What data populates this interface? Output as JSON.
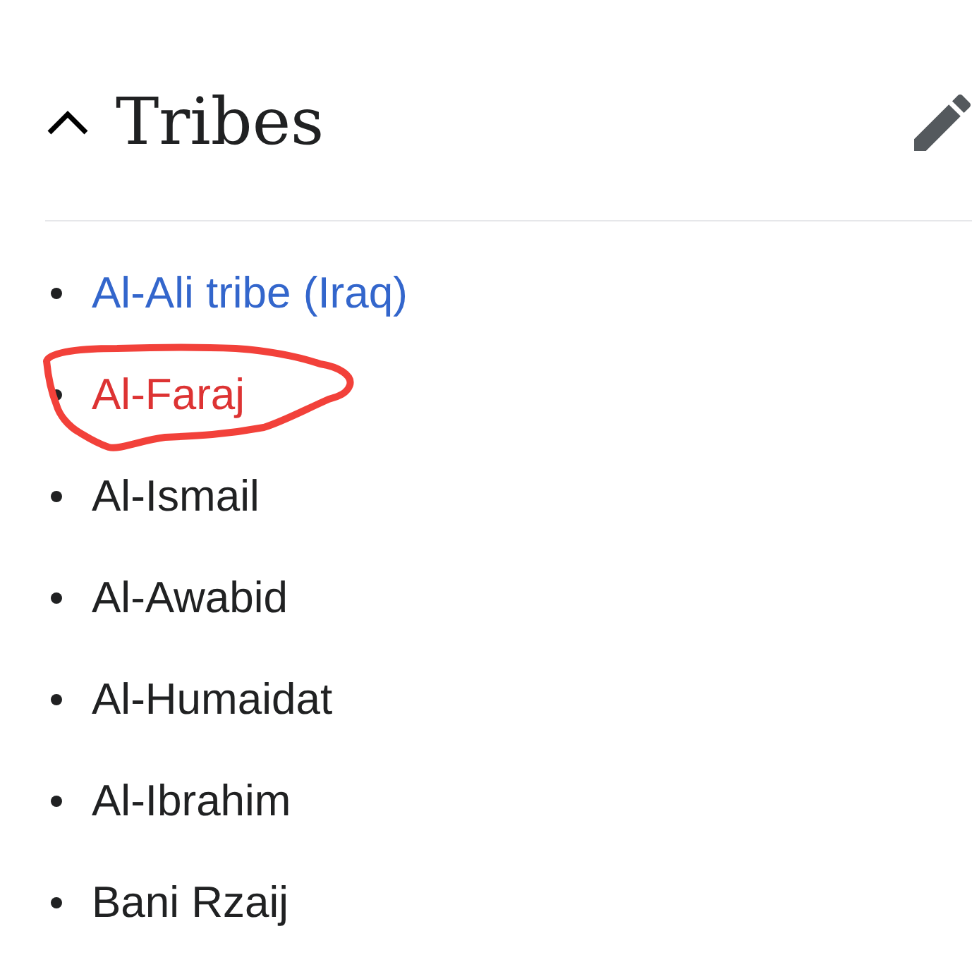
{
  "section": {
    "title": "Tribes",
    "expanded": true
  },
  "items": [
    {
      "label": "Al-Ali tribe (Iraq)",
      "kind": "link",
      "circled": false
    },
    {
      "label": "Al-Faraj",
      "kind": "redlink",
      "circled": true
    },
    {
      "label": "Al-Ismail",
      "kind": "text",
      "circled": false
    },
    {
      "label": "Al-Awabid",
      "kind": "text",
      "circled": false
    },
    {
      "label": "Al-Humaidat",
      "kind": "text",
      "circled": false
    },
    {
      "label": "Al-Ibrahim",
      "kind": "text",
      "circled": false
    },
    {
      "label": "Bani Rzaij",
      "kind": "text",
      "circled": false
    }
  ]
}
